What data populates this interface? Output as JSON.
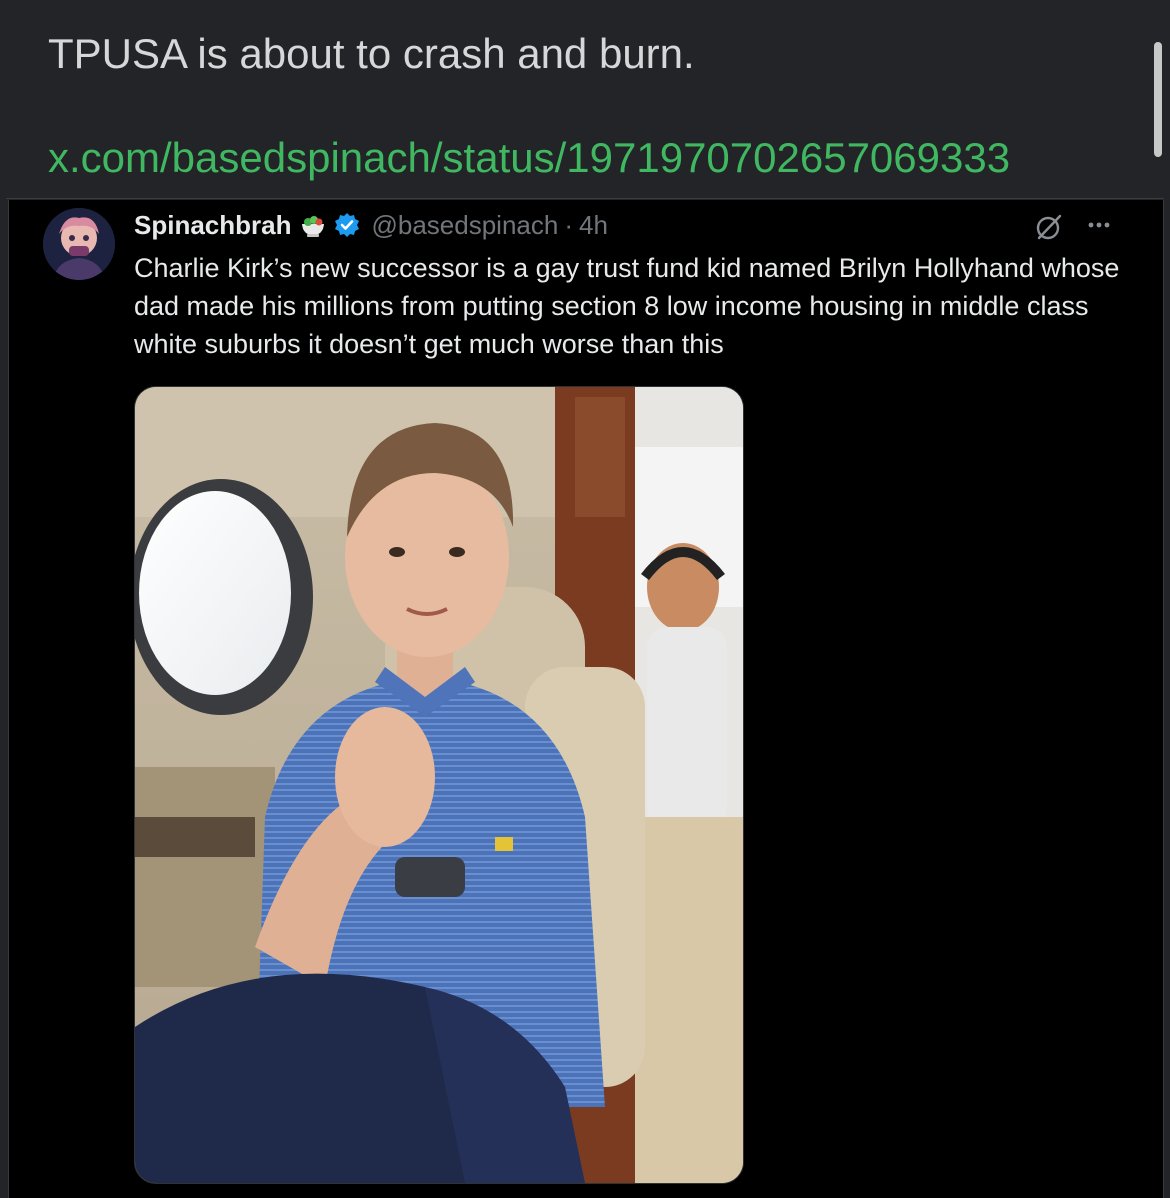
{
  "post": {
    "text": "TPUSA is about to crash and burn.",
    "link": "x.com/basedspinach/status/1971970702657069333"
  },
  "tweet": {
    "display_name": "Spinachbrah",
    "handle": "@basedspinach",
    "separator": "·",
    "time": "4h",
    "body": "Charlie Kirk’s new successor is a gay trust fund kid named Brilyn Hollyhand whose dad made his millions from putting section 8 low income housing in middle class white suburbs it doesn’t get much worse than this",
    "name_emoji": "salad-bowl-icon",
    "verified_badge": "verified-badge-icon"
  },
  "colors": {
    "page_bg": "#232427",
    "embed_bg": "#000000",
    "link": "#3fb861",
    "verified": "#1d9bf0",
    "muted": "#71767b"
  }
}
